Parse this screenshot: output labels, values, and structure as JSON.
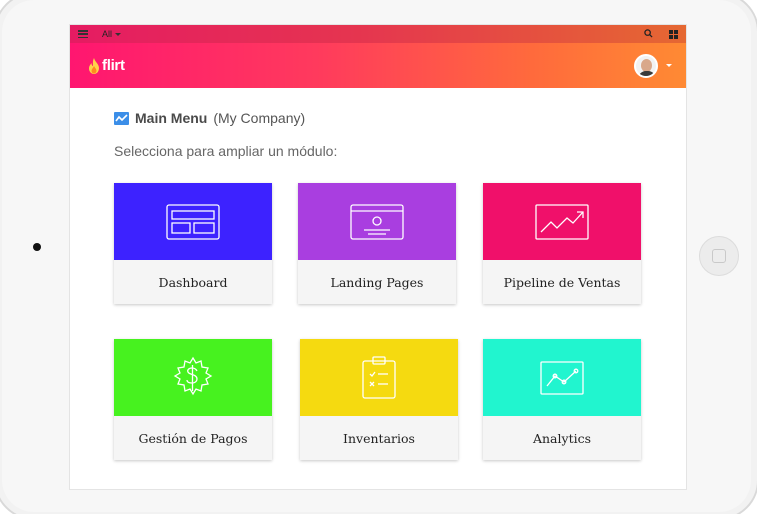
{
  "system_bar": {
    "menu_icon": "hamburger-icon",
    "filter_label": "All",
    "search_icon": "search-icon",
    "apps_icon": "apps-grid-icon"
  },
  "brand": {
    "logo_text": "flirt",
    "logo_icon": "flame-icon",
    "user_avatar": "user-avatar",
    "user_menu_icon": "chevron-down-icon"
  },
  "main": {
    "title": "Main Menu",
    "company": "(My Company)",
    "title_icon": "chart-icon",
    "subtitle": "Selecciona para ampliar un módulo:"
  },
  "modules": [
    {
      "label": "Dashboard",
      "color": "#3d22ff",
      "icon": "dashboard-icon"
    },
    {
      "label": "Landing Pages",
      "color": "#a93ee0",
      "icon": "landing-page-icon"
    },
    {
      "label": "Pipeline de Ventas",
      "color": "#f0106a",
      "icon": "sales-trend-icon"
    },
    {
      "label": "Gestión de Pagos",
      "color": "#47f21f",
      "icon": "dollar-gear-icon"
    },
    {
      "label": "Inventarios",
      "color": "#f5da10",
      "icon": "clipboard-checklist-icon"
    },
    {
      "label": "Analytics",
      "color": "#21f5cf",
      "icon": "analytics-chart-icon"
    }
  ],
  "colors": {
    "gradient_start": "#ff1670",
    "gradient_end": "#ff8a33"
  }
}
